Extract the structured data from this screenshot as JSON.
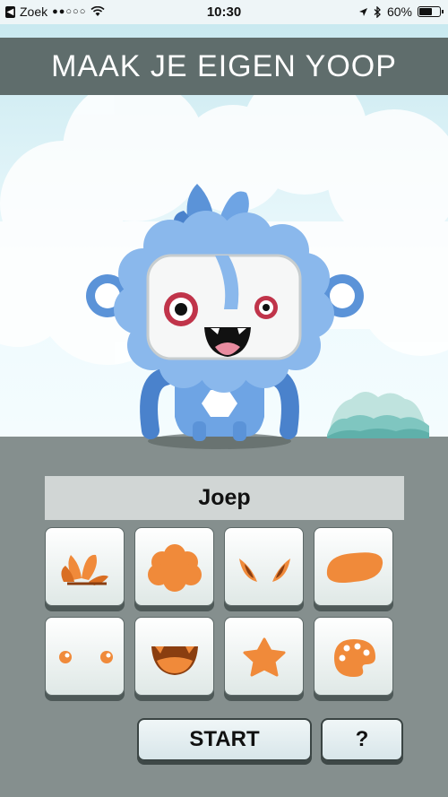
{
  "status_bar": {
    "carrier": "Zoek",
    "time": "10:30",
    "battery": "60%",
    "battery_level": 0.6
  },
  "header": {
    "title": "MAAK JE EIGEN YOOP"
  },
  "character": {
    "name": "Joep"
  },
  "parts": [
    {
      "name": "hair-part",
      "icon": "hair-icon"
    },
    {
      "name": "fur-part",
      "icon": "fur-icon"
    },
    {
      "name": "ears-part",
      "icon": "ears-icon"
    },
    {
      "name": "face-shape-part",
      "icon": "face-shape-icon"
    },
    {
      "name": "eyes-part",
      "icon": "eyes-icon"
    },
    {
      "name": "mouth-part",
      "icon": "mouth-icon"
    },
    {
      "name": "body-part",
      "icon": "star-icon"
    },
    {
      "name": "color-part",
      "icon": "palette-icon"
    }
  ],
  "buttons": {
    "start": "START",
    "help": "?"
  },
  "colors": {
    "accent": "#f08a3a",
    "yoop_blue": "#5b93d8",
    "ground": "#858f8e"
  }
}
